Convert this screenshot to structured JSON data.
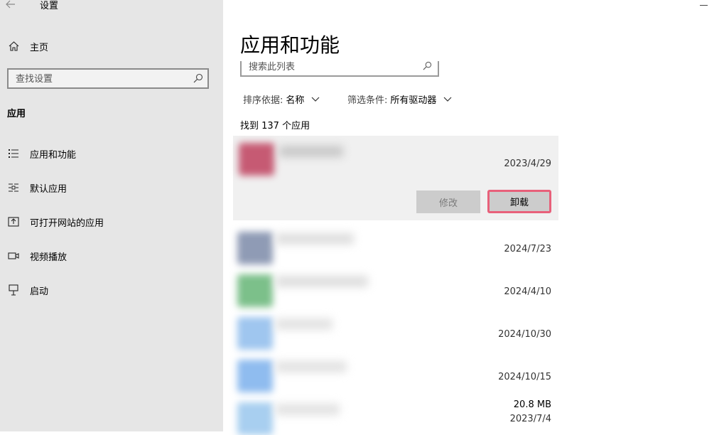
{
  "window": {
    "title": "设置",
    "back_icon": "arrow-left-icon",
    "minimize_icon": "minimize-icon"
  },
  "sidebar": {
    "home_label": "主页",
    "search_placeholder": "查找设置",
    "section_title": "应用",
    "items": [
      {
        "label": "应用和功能",
        "icon": "list-icon"
      },
      {
        "label": "默认应用",
        "icon": "default-apps-icon"
      },
      {
        "label": "可打开网站的应用",
        "icon": "open-website-icon"
      },
      {
        "label": "视频播放",
        "icon": "video-icon"
      },
      {
        "label": "启动",
        "icon": "startup-icon"
      }
    ]
  },
  "main": {
    "title": "应用和功能",
    "list_search_placeholder": "搜索此列表",
    "sort": {
      "label": "排序依据:",
      "value": "名称"
    },
    "filter": {
      "label": "筛选条件:",
      "value": "所有驱动器"
    },
    "count_text": "找到 137 个应用",
    "apps": [
      {
        "date": "2023/4/29",
        "size": "",
        "icon_color": "#c65a73",
        "selected": true
      },
      {
        "date": "2024/7/23",
        "size": "",
        "icon_color": "#8f9bb5"
      },
      {
        "date": "2024/4/10",
        "size": "",
        "icon_color": "#7cc08a"
      },
      {
        "date": "2024/10/30",
        "size": "",
        "icon_color": "#9fc6ef"
      },
      {
        "date": "2024/10/15",
        "size": "",
        "icon_color": "#8fbcef"
      },
      {
        "date": "2023/7/4",
        "size": "20.8 MB",
        "icon_color": "#a8cff0"
      }
    ],
    "buttons": {
      "modify": "修改",
      "uninstall": "卸载"
    },
    "colors": {
      "highlight_border": "#e8607a",
      "sidebar_bg": "#e6e6e6",
      "selected_bg": "#f0f0f0"
    }
  }
}
